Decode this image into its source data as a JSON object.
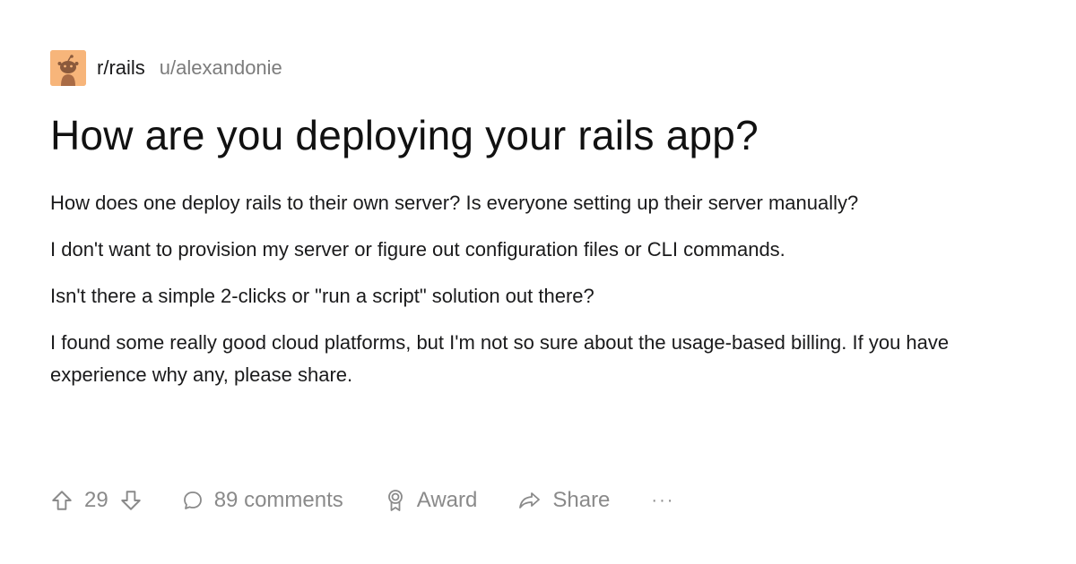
{
  "post": {
    "subreddit": "r/rails",
    "author": "u/alexandonie",
    "title": "How are you deploying your rails app?",
    "body": [
      "How does one deploy rails to their own server? Is everyone setting up their server manually?",
      "I don't want to provision my server or figure out configuration  files or CLI commands.",
      "Isn't there a simple 2-clicks or \"run a script\" solution out there?",
      "I found some really good cloud platforms, but I'm not so sure about the usage-based billing. If you have experience  why any, please share."
    ]
  },
  "actions": {
    "vote_count": "29",
    "comments_label": "89 comments",
    "award_label": "Award",
    "share_label": "Share",
    "more_label": "···"
  },
  "icons": {
    "avatar": "reddit-snoo-avatar",
    "upvote": "arrow-up-icon",
    "downvote": "arrow-down-icon",
    "comments": "speech-bubble-icon",
    "award": "award-ribbon-icon",
    "share": "share-arrow-icon",
    "more": "ellipsis-icon"
  },
  "colors": {
    "avatar_bg": "#f7b57a",
    "muted_text": "#8a8a8a"
  }
}
